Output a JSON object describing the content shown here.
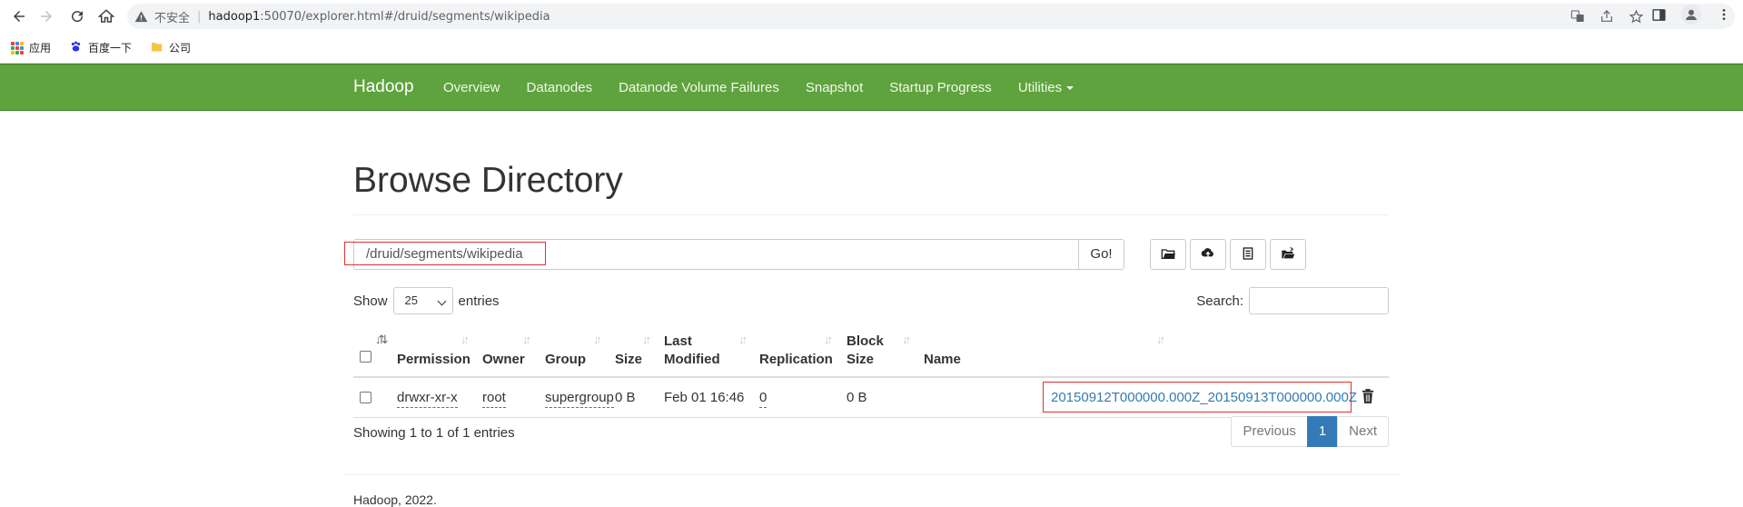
{
  "browser": {
    "insecure_label": "不安全",
    "url_host": "hadoop1",
    "url_rest": ":50070/explorer.html#/druid/segments/wikipedia",
    "bookmarks": [
      {
        "label": "应用",
        "icon": "apps-grid-icon"
      },
      {
        "label": "百度一下",
        "icon": "baidu-paw-icon"
      },
      {
        "label": "公司",
        "icon": "folder-icon"
      }
    ]
  },
  "navbar": {
    "brand": "Hadoop",
    "links": [
      "Overview",
      "Datanodes",
      "Datanode Volume Failures",
      "Snapshot",
      "Startup Progress",
      "Utilities"
    ],
    "color": "#5fa33e"
  },
  "page": {
    "title": "Browse Directory",
    "path_value": "/druid/segments/wikipedia",
    "go_label": "Go!",
    "tool_icons": [
      "create-folder-icon",
      "upload-icon",
      "cut-paste-icon",
      "folder-open-icon"
    ],
    "show_label": "Show",
    "entries_value": "25",
    "entries_label": "entries",
    "search_label": "Search:",
    "search_value": ""
  },
  "table": {
    "headers": [
      "Permission",
      "Owner",
      "Group",
      "Size",
      "Last Modified",
      "Replication",
      "Block Size",
      "Name"
    ],
    "header_lines": {
      "last_modified": [
        "Last",
        "Modified"
      ],
      "block_size": [
        "Block",
        "Size"
      ]
    },
    "rows": [
      {
        "permission": "drwxr-xr-x",
        "owner": "root",
        "group": "supergroup",
        "size": "0 B",
        "last_modified": "Feb 01 16:46",
        "replication": "0",
        "block_size": "0 B",
        "name": "20150912T000000.000Z_20150913T000000.000Z"
      }
    ]
  },
  "info": "Showing 1 to 1 of 1 entries",
  "pagination": {
    "previous": "Previous",
    "current": "1",
    "next": "Next"
  },
  "footer": "Hadoop, 2022.",
  "colors": {
    "link": "#337ab7",
    "highlight": "#e03030"
  }
}
